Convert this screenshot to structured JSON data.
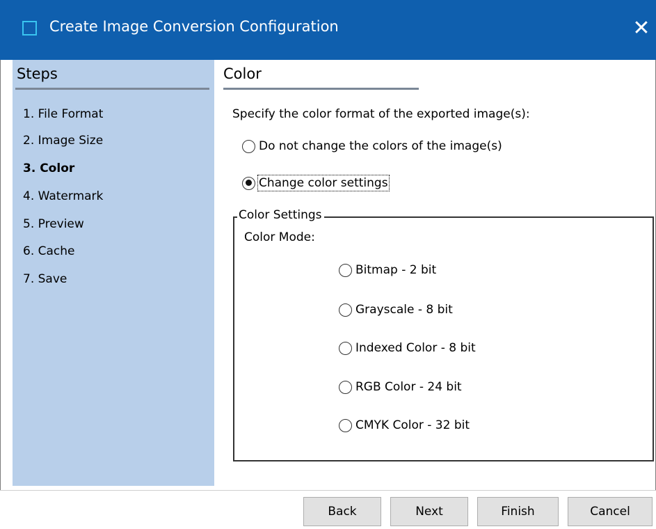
{
  "window": {
    "title": "Create Image Conversion Configuration",
    "close_glyph": "✕"
  },
  "sidebar": {
    "heading": "Steps",
    "items": [
      {
        "label": "1. File Format",
        "active": false
      },
      {
        "label": "2. Image Size",
        "active": false
      },
      {
        "label": "3. Color",
        "active": true
      },
      {
        "label": "4. Watermark",
        "active": false
      },
      {
        "label": "5. Preview",
        "active": false
      },
      {
        "label": "6. Cache",
        "active": false
      },
      {
        "label": "7. Save",
        "active": false
      }
    ]
  },
  "main": {
    "heading": "Color",
    "prompt": "Specify the color format of the exported image(s):",
    "options": [
      {
        "label": "Do not change the colors of the image(s)",
        "selected": false
      },
      {
        "label": "Change color settings",
        "selected": true
      }
    ],
    "color_settings": {
      "legend": "Color Settings",
      "mode_label": "Color Mode:",
      "modes": [
        {
          "label": "Bitmap - 2 bit",
          "selected": false
        },
        {
          "label": "Grayscale - 8 bit",
          "selected": false
        },
        {
          "label": "Indexed Color - 8 bit",
          "selected": false
        },
        {
          "label": "RGB Color - 24 bit",
          "selected": false
        },
        {
          "label": "CMYK Color - 32 bit",
          "selected": false
        }
      ]
    }
  },
  "buttons": {
    "back": "Back",
    "next": "Next",
    "finish": "Finish",
    "cancel": "Cancel"
  },
  "colors": {
    "titlebar": "#0f5fae",
    "sidebar": "#b8cfea",
    "app_icon_border": "#39c5f0"
  }
}
